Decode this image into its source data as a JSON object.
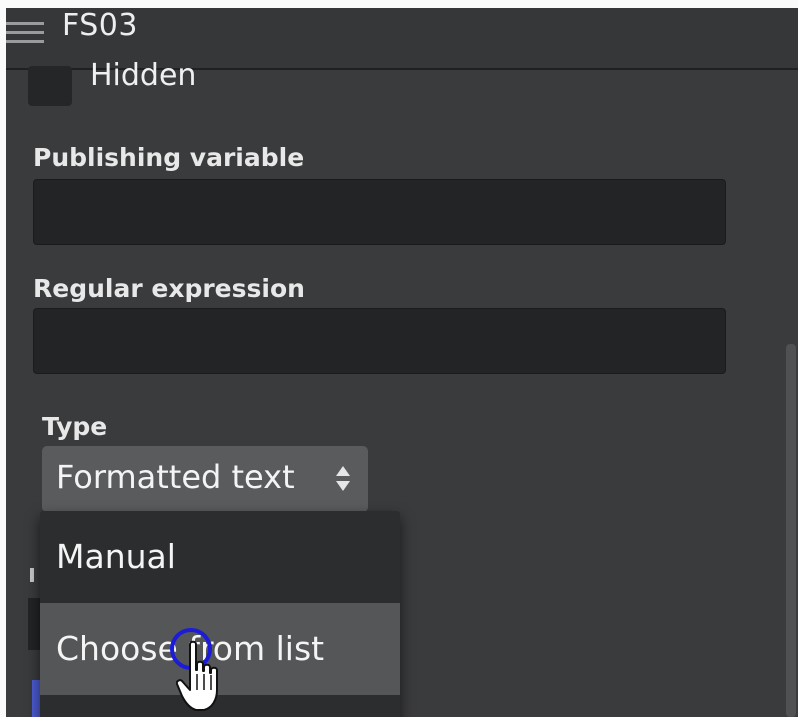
{
  "header": {
    "title": "FS03",
    "menu_icon": "hamburger-menu-icon"
  },
  "form": {
    "hidden_label": "Hidden",
    "hidden_checked": false,
    "publishing_variable": {
      "label": "Publishing variable",
      "value": ""
    },
    "regular_expression": {
      "label": "Regular expression",
      "value": ""
    },
    "type": {
      "label": "Type",
      "selected": "Formatted text",
      "options": [
        "Manual",
        "Choose from list"
      ]
    }
  },
  "colors": {
    "panel_bg": "#3a3b3d",
    "input_bg": "#232425",
    "select_bg": "#5a5b5d",
    "dropdown_bg": "#2c2d2e",
    "hover_bg": "#555658",
    "accent": "#4c5bd4"
  }
}
